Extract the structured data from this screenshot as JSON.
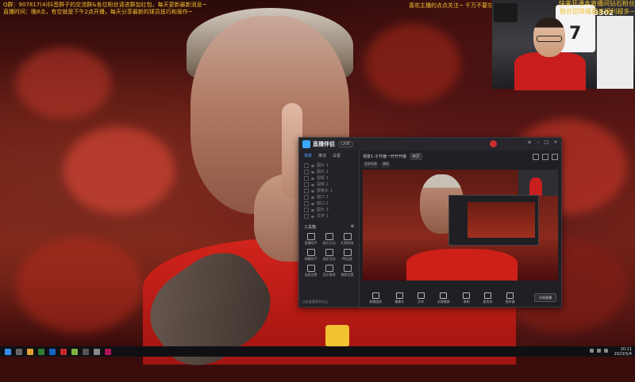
{
  "overlay": {
    "top_line_1": "Q群：907817(4)抖音群子的交流群&各位粉丝请进群加红包，每天更新最新消息~",
    "top_line_2": "直播时间：晚8点，有空就是下午2点开播，每天分享最新的球员技巧和操作~",
    "right_ticker": "喜欢主播的点点关注~ 千万不要忘记点赞哦~",
    "promo_line_1": "快来开通本直播间钻石粉丝",
    "promo_line_2": "粉丝团等级越高福利越多~"
  },
  "webcam": {
    "jersey_number": "7",
    "overlay_text": "3302"
  },
  "app": {
    "name": "直播伴侣",
    "tag": "LIVE",
    "side_tabs": [
      "场景",
      "推流",
      "设置"
    ],
    "side_items": [
      "图片 1",
      "图片 2",
      "视频 1",
      "视频 2",
      "摄像头 1",
      "窗口 1",
      "窗口 2",
      "图片 3",
      "文字 1"
    ],
    "tools_title": "工具箱",
    "tools": [
      "直播助手",
      "观众互动",
      "礼物特效",
      "弹幕助手",
      "抽奖活动",
      "PK连麦",
      "连麦设置",
      "音乐管理",
      "美颜设置"
    ],
    "footer": "点此查看更多玩法",
    "main_title": "场景1:子开播一开开开播",
    "main_chip": "横屏",
    "main_subtabs": [
      "竖屏场景",
      "横屏"
    ],
    "controls": [
      "直播画质",
      "摄像头",
      "文本",
      "全屏截屏",
      "录制",
      "麦克风",
      "扬声器"
    ],
    "start_button": "开始直播"
  },
  "taskbar": {
    "time": "20:11",
    "date": "2023/5/4"
  }
}
